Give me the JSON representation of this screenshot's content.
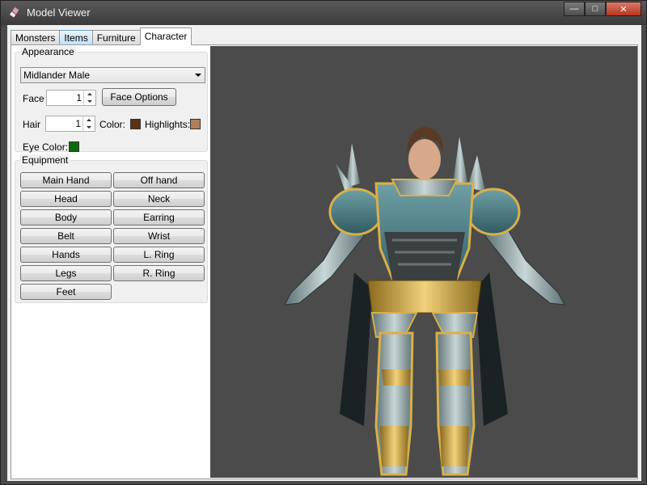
{
  "window": {
    "title": "Model Viewer",
    "controls": {
      "minimize": "—",
      "maximize": "□",
      "close": "✕"
    }
  },
  "tabs": [
    {
      "label": "Monsters"
    },
    {
      "label": "Items"
    },
    {
      "label": "Furniture"
    },
    {
      "label": "Character"
    }
  ],
  "appearance": {
    "group_title": "Appearance",
    "race_select": "Midlander Male",
    "face_label": "Face",
    "face_value": "1",
    "face_options_button": "Face Options",
    "hair_label": "Hair",
    "hair_value": "1",
    "color_label": "Color:",
    "highlights_label": "Highlights:",
    "eye_color_label": "Eye Color:",
    "colors": {
      "hair": "#5a3317",
      "highlights": "#b07e5c",
      "eye": "#0a6b0a"
    }
  },
  "equipment": {
    "group_title": "Equipment",
    "slots": [
      "Main Hand",
      "Off hand",
      "Head",
      "Neck",
      "Body",
      "Earring",
      "Belt",
      "Wrist",
      "Hands",
      "L. Ring",
      "Legs",
      "R. Ring",
      "Feet"
    ]
  },
  "viewport": {
    "background": "#4b4b4b",
    "model_icon": "armored-character-model"
  }
}
